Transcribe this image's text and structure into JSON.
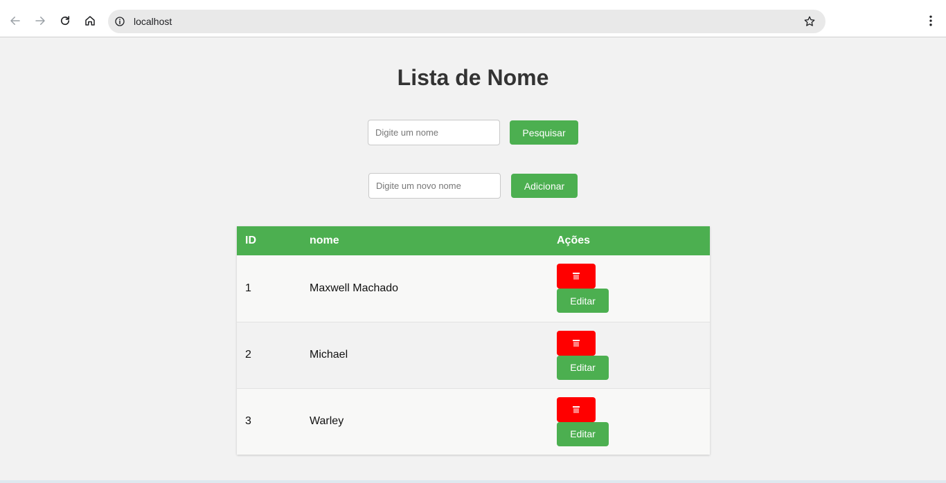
{
  "browser": {
    "url": "localhost"
  },
  "page": {
    "title": "Lista de Nome",
    "search": {
      "placeholder": "Digite um nome",
      "button_label": "Pesquisar"
    },
    "add": {
      "placeholder": "Digite um novo nome",
      "button_label": "Adicionar"
    }
  },
  "table": {
    "headers": {
      "id": "ID",
      "nome": "nome",
      "acoes": "Ações"
    },
    "rows": [
      {
        "id": "1",
        "nome": "Maxwell Machado",
        "edit_label": "Editar"
      },
      {
        "id": "2",
        "nome": "Michael",
        "edit_label": "Editar"
      },
      {
        "id": "3",
        "nome": "Warley",
        "edit_label": "Editar"
      }
    ]
  },
  "colors": {
    "accent": "#4caf50",
    "danger": "#ff0000",
    "background": "#f2f2f2"
  },
  "icons": {
    "back": "arrow-left-icon",
    "forward": "arrow-right-icon",
    "reload": "reload-icon",
    "home": "home-icon",
    "info": "info-icon",
    "bookmark": "star-icon",
    "menu": "kebab-menu-icon",
    "delete": "trash-icon"
  }
}
